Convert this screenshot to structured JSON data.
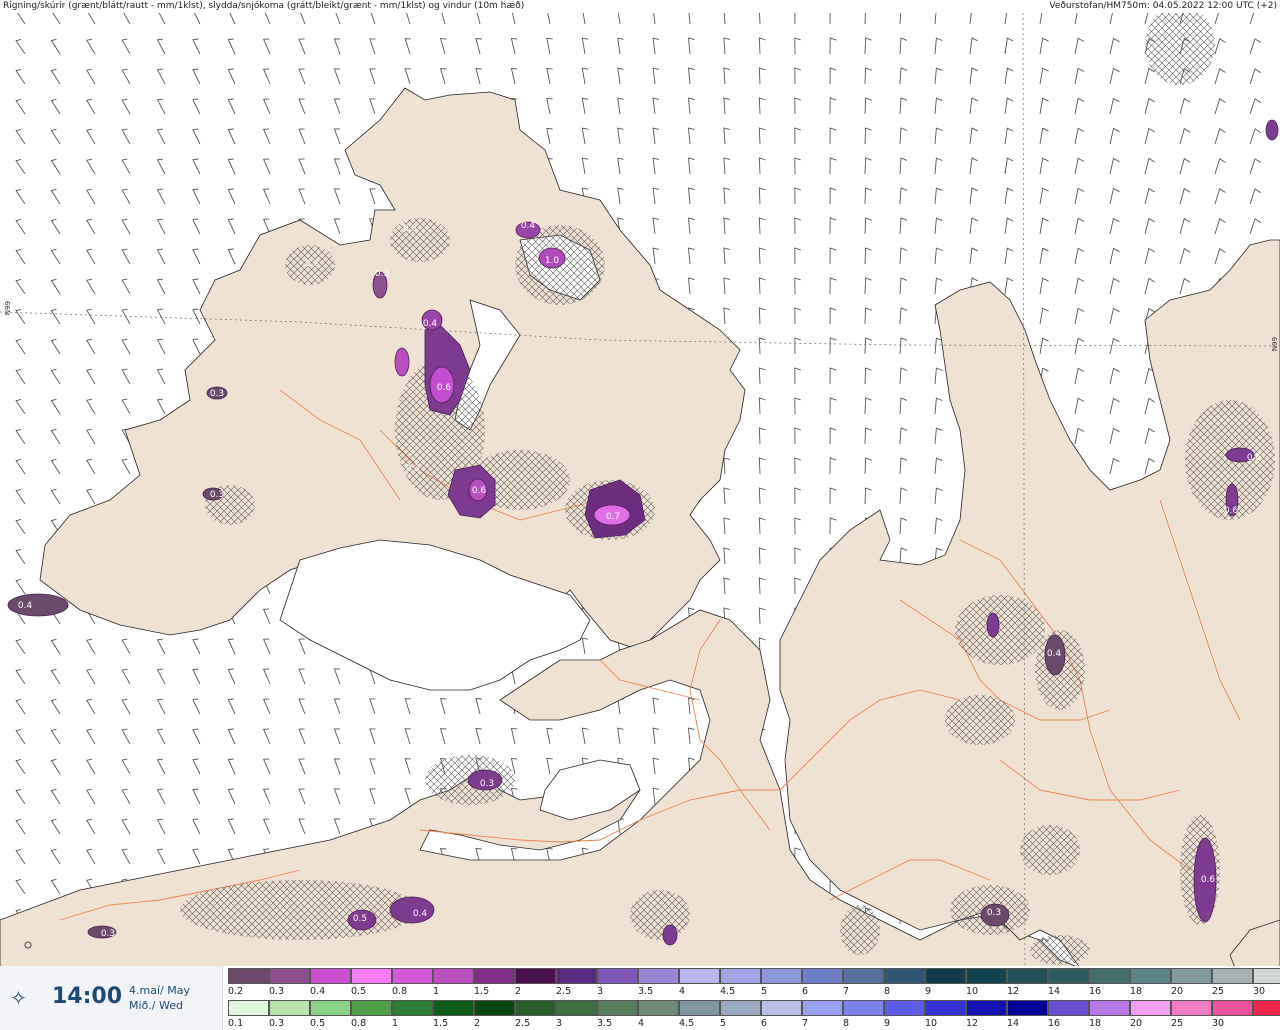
{
  "header": {
    "title": "Rigning/skúrir (grænt/blátt/rautt - mm/1klst), slydda/snjókoma (grátt/bleikt/grænt - mm/1klst) og vindur (10m hæð)",
    "source": "Veðurstofan/HM750m: 04.05.2022 12:00 UTC (+2)"
  },
  "map": {
    "lat_label_left": "N99",
    "lat_label_right": "N99",
    "colors": {
      "land": "#f0e2d3",
      "sea": "#ffffff",
      "roads": "#e8824e",
      "snow": "#9b44a8"
    },
    "precip_labels": [
      {
        "text": "0.3"
      },
      {
        "text": "0.3"
      },
      {
        "text": "0.3"
      },
      {
        "text": "0.4"
      },
      {
        "text": "1.0"
      },
      {
        "text": "0.4"
      },
      {
        "text": "0.6"
      },
      {
        "text": "0.3"
      },
      {
        "text": "0.3"
      },
      {
        "text": "0.6"
      },
      {
        "text": "0.7"
      },
      {
        "text": "0.4"
      },
      {
        "text": "0.3"
      },
      {
        "text": "0.5"
      },
      {
        "text": "0.4"
      },
      {
        "text": "0.3"
      },
      {
        "text": "0.3"
      },
      {
        "text": "0.4"
      },
      {
        "text": "0.6"
      },
      {
        "text": "0.6"
      },
      {
        "text": "0.3"
      },
      {
        "text": "0.6"
      }
    ]
  },
  "footer": {
    "time": "14:00",
    "date_line1": "4.maí/ May",
    "date_line2": "Mið./ Wed",
    "snow_scale": {
      "colors": [
        "#6b4a6b",
        "#8e4f90",
        "#c94fd0",
        "#f47cf4",
        "#d25ad6",
        "#b94fbd",
        "#7e2e83",
        "#4a0f4e",
        "#5a2a80",
        "#7d55b4",
        "#9b86d6",
        "#b9b5ee",
        "#a3a6e4",
        "#8d98d8",
        "#6e7ec4",
        "#55709c",
        "#2f5674",
        "#0f3d4c",
        "#134451",
        "#1f5156",
        "#2b5c60",
        "#44716f",
        "#5c8486",
        "#809a9e",
        "#a4b2b4",
        "#d3d7d8",
        "#ffffff"
      ],
      "labels": [
        "0.2",
        "0.3",
        "0.4",
        "0.5",
        "0.8",
        "1",
        "1.5",
        "2",
        "2.5",
        "3",
        "3.5",
        "4",
        "4.5",
        "5",
        "6",
        "7",
        "8",
        "9",
        "10",
        "12",
        "14",
        "16",
        "18",
        "20",
        "25",
        "30"
      ]
    },
    "rain_scale": {
      "colors": [
        "#dff8dc",
        "#b6e6ae",
        "#8cd384",
        "#4ea04b",
        "#2e7d33",
        "#0c5a15",
        "#0a4812",
        "#275e2a",
        "#3f7044",
        "#587e5d",
        "#6e8c77",
        "#7f98a0",
        "#98a9c0",
        "#b8c0e6",
        "#9aa0f0",
        "#7d82ec",
        "#5c5ce6",
        "#3232d2",
        "#1414b4",
        "#000096",
        "#6c50d2",
        "#b878e6",
        "#f0a0f0",
        "#f07cc8",
        "#f050a0",
        "#f02850",
        "#f00000"
      ],
      "labels": [
        "0.1",
        "0.3",
        "0.5",
        "0.8",
        "1",
        "1.5",
        "2",
        "2.5",
        "3",
        "3.5",
        "4",
        "4.5",
        "5",
        "6",
        "7",
        "8",
        "9",
        "10",
        "12",
        "14",
        "16",
        "18",
        "20",
        "25",
        "30"
      ]
    }
  }
}
